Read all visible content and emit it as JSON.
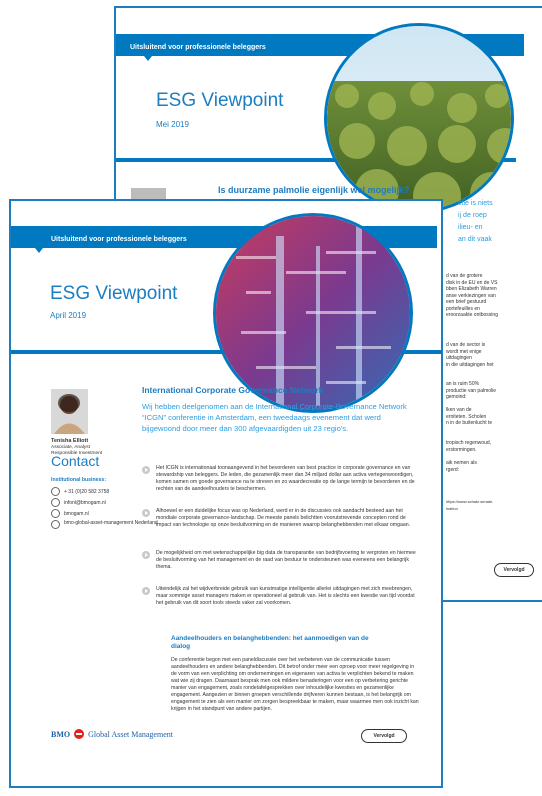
{
  "back_page": {
    "band_label": "Uitsluitend voor professionele beleggers",
    "title": "ESG Viewpoint",
    "date": "Mei 2019",
    "heading": "Is duurzame palmolie eigenlijk wel mogelijk?",
    "lead_fragments": [
      "ctie is niets",
      "ij de roep",
      "ilieu- en",
      "an dit vaak"
    ],
    "text_fragments": [
      "d van de grotere",
      "disk in de EU en de VS",
      "bben Elizabeth Warren",
      "anse verkiezingen van",
      "een brief gestuurd",
      "portefeuilles en",
      "eroorzaakte ontbossing",
      "d van de sector is",
      "wordt met enige",
      "uitdagingen",
      "in die uitdagingen het",
      "an is ruim 50%",
      "productie van palmolie",
      "gemoind:",
      "lken van de",
      "erniteten. Scholen",
      "n in de buitenlucht te",
      "tropisch regenwoud,",
      "erstormingen.",
      "aik nemen als",
      "rgerd:",
      "https://www.schatz.senate.",
      "ination"
    ],
    "button": "Vervolgd"
  },
  "front_page": {
    "band_label": "Uitsluitend voor professionele beleggers",
    "title": "ESG Viewpoint",
    "date": "April 2019",
    "author": {
      "name": "Tenisha Elliott",
      "role1": "Associate, Analyst",
      "role2": "Responsible Investment"
    },
    "contact": {
      "heading": "Contact",
      "business_label": "Institutional business:",
      "phone": "+ 31 (0)20 582 3758",
      "email": "infonl@bmogam.nl",
      "web": "bmogam.nl",
      "linkedin": "bmo-global-asset-management Nederland"
    },
    "heading": "International Corporate Governance Network",
    "lead": "Wij hebben deelgenomen aan de International Corporate Governance Network “ICGN” conferentie in Amsterdam, een tweedaags evenement dat werd bijgewoond door meer dan 300 afgevaardigden uit 23 regio's.",
    "bullets": [
      "Het ICGN is internationaal toonaangevend in het bevorderen van best practice in corporate governance en van stewardship van beleggers. De leden, die gezamenlijk meer dan 34 miljard dollar aan activa vertegenwoordigen, komen samen om goede governance na te streven en zo waardecreatie op de lange termijn te bevorderen en de rechten van de aandeelhouders te beschermen.",
      "Alhoewel er een duidelijke focus was op Nederland, werd er in de discussies ook aandacht besteed aan het mondiale corporate governance-landschap. De meeste panels belichtten voorutstrevende concepten rond de impact van technologie op onze besluitvorming en de manieren waarop belanghebbenden met elkaar omgaan.",
      "De mogelijkheid om met wetenschappelijke big data de transparantie van bedrijfsvoering te vergroten en hiermee de besluitvorming van het management en de raad van bestuur te ondersteunen was eveneens een belangrijk thema.",
      "Uiteindelijk zal het wijdverbreide gebruik van kunstmatige intelligentie allerlei uitdagingen met zich meebrengen, maar sommige asset managers maken er operationeel al gebruik van. Het is slechts een kwestie van tijd voordat het gebruik van dit soort tools steeds vaker zal voorkomen."
    ],
    "section2_heading": "Aandeelhouders en belanghebbenden: het aanmoedigen van de dialog",
    "section2_body": "De conferentie begon met een paneldiscussie over het verbeteren van de communicatie tussen aandeelhouders en andere belanghebbenden. Dit betrof onder meer een oproep voor meer regelgeving in de vorm van een verplichting om ondernemingen en eigenaren van activa te verplichten bekend te maken wat wie zij dragen. Daarnaast besprak men ook mildere benaderingen voor een op verbetering gerichte manier van engagement, zoals rondetafelgesprekken over inhoudelijke kwesties en gezamenlijke engagement. Aangezien er binnen groepen verschillende drijfveren kunnen bestaan, is het belangrijk om engagement te zien als een manier om zorgen bespreekbaar te maken, maar waarmee men ook inzicht kan krijgen in het standpunt van andere partijen.",
    "logo_bmo": "BMO",
    "logo_gam": "Global Asset Management",
    "button": "Vervolgd"
  },
  "colors": {
    "brand_blue": "#0079c1",
    "accent_blue": "#2e9ee0",
    "logo_red": "#e2231a"
  }
}
